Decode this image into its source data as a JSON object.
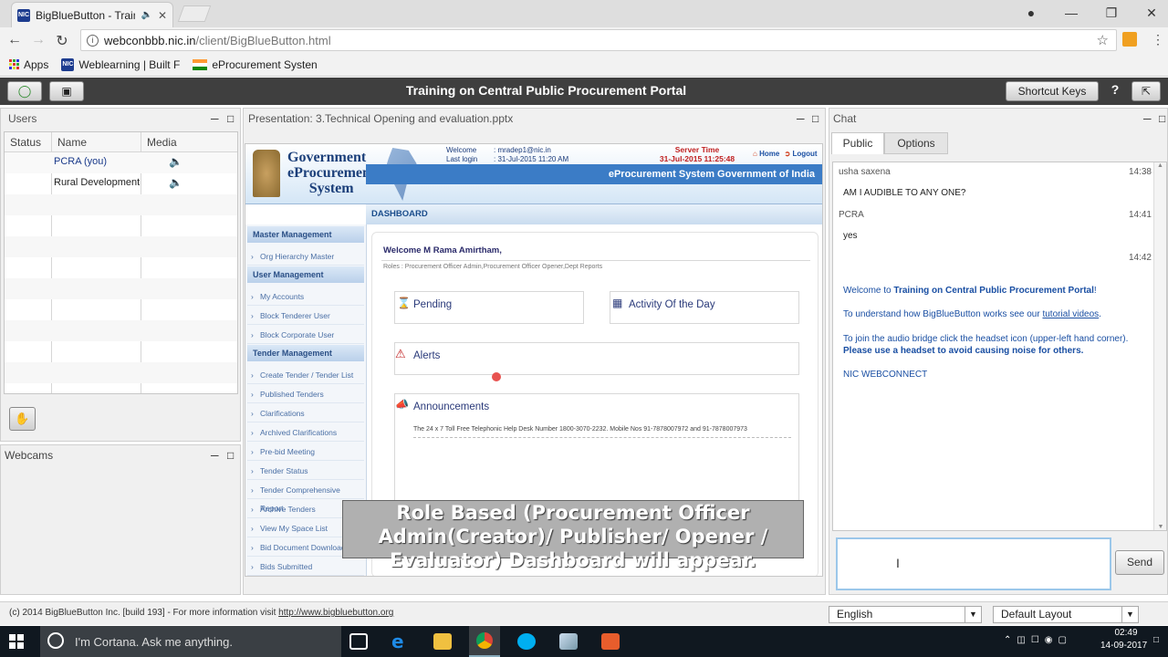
{
  "browser": {
    "tab_title": "BigBlueButton - Traini",
    "favicon_text": "NIC",
    "url_host": "webconbbb.nic.in",
    "url_path": "/client/BigBlueButton.html",
    "bookmarks": [
      "Apps",
      "Weblearning | Built F",
      "eProcurement Systen"
    ]
  },
  "app": {
    "title": "Training on Central Public Procurement Portal",
    "shortcut_keys": "Shortcut Keys",
    "help": "?"
  },
  "users_panel": {
    "title": "Users",
    "columns": [
      "Status",
      "Name",
      "Media"
    ],
    "rows": [
      {
        "name": "PCRA (you)"
      },
      {
        "name": "Rural Development"
      }
    ]
  },
  "webcams_panel": {
    "title": "Webcams"
  },
  "presentation": {
    "title": "Presentation: 3.Technical Opening and evaluation.pptx",
    "slide": {
      "logo_line1": "Government",
      "logo_line2": "eProcurement",
      "logo_line3": "System",
      "welcome_label": "Welcome",
      "welcome_value": ": mradep1@nic.in",
      "lastlogin_label": "Last login",
      "lastlogin_value": ": 31-Jul-2015 11:20 AM",
      "server_time_label": "Server Time",
      "server_time_value": "31-Jul-2015 11:25:48",
      "home": "Home",
      "logout": "Logout",
      "banner": "eProcurement System Government of India",
      "dashboard": "DASHBOARD",
      "nav": [
        {
          "type": "h",
          "label": "Master Management"
        },
        {
          "type": "i",
          "label": "Org Hierarchy Master"
        },
        {
          "type": "h",
          "label": "User Management"
        },
        {
          "type": "i",
          "label": "My Accounts"
        },
        {
          "type": "i",
          "label": "Block Tenderer User"
        },
        {
          "type": "i",
          "label": "Block Corporate User"
        },
        {
          "type": "h",
          "label": "Tender Management"
        },
        {
          "type": "i",
          "label": "Create Tender / Tender List"
        },
        {
          "type": "i",
          "label": "Published Tenders"
        },
        {
          "type": "i",
          "label": "Clarifications"
        },
        {
          "type": "i",
          "label": "Archived Clarifications"
        },
        {
          "type": "i",
          "label": "Pre-bid Meeting"
        },
        {
          "type": "i",
          "label": "Tender Status"
        },
        {
          "type": "i",
          "label": "Tender Comprehensive Report"
        },
        {
          "type": "i",
          "label": "Archive Tenders"
        },
        {
          "type": "i",
          "label": "View My Space List"
        },
        {
          "type": "i",
          "label": "Bid Document Download"
        },
        {
          "type": "i",
          "label": "Bids Submitted"
        }
      ],
      "welcome_user": "Welcome M Rama Amirtham,",
      "roles": "Roles : Procurement Officer Admin,Procurement Officer Opener,Dept Reports",
      "pending": "Pending",
      "activity": "Activity Of the Day",
      "alerts": "Alerts",
      "announcements": "Announcements",
      "announcement_text": "The 24 x 7 Toll Free Telephonic Help Desk Number 1800-3070-2232. Mobile Nos 91-7878007972 and 91-7878007973"
    },
    "caption": "Role Based (Procurement Officer Admin(Creator)/ Publisher/ Opener / Evaluator) Dashboard will appear."
  },
  "chat": {
    "title": "Chat",
    "tabs": [
      "Public",
      "Options"
    ],
    "messages": [
      {
        "name": "usha saxena",
        "time": "14:38",
        "text": "AM I AUDIBLE TO ANY ONE?"
      },
      {
        "name": "PCRA",
        "time": "14:41",
        "text": "yes"
      }
    ],
    "system_time": "14:42",
    "welcome_pre": "Welcome to ",
    "welcome_bold": "Training on Central Public Procurement Portal",
    "welcome_post": "!",
    "tutorial_pre": "To understand how BigBlueButton works see our ",
    "tutorial_link": "tutorial videos",
    "tutorial_post": ".",
    "audio_pre": "To join the audio bridge click the headset icon (upper-left hand corner). ",
    "audio_bold": "Please use a headset to avoid causing noise for others.",
    "signoff": "NIC WEBCONNECT",
    "send": "Send"
  },
  "footer": {
    "copyright": "(c) 2014 BigBlueButton Inc. [build 193] - For more information visit ",
    "link": "http://www.bigbluebutton.org",
    "language": "English",
    "layout": "Default Layout"
  },
  "taskbar": {
    "cortana": "I'm Cortana. Ask me anything.",
    "time": "02:49",
    "date": "14-09-2017"
  },
  "colors": {
    "toolbar": "#3f3f3f",
    "link_blue": "#1a4fa3",
    "taskbar": "#101820"
  }
}
